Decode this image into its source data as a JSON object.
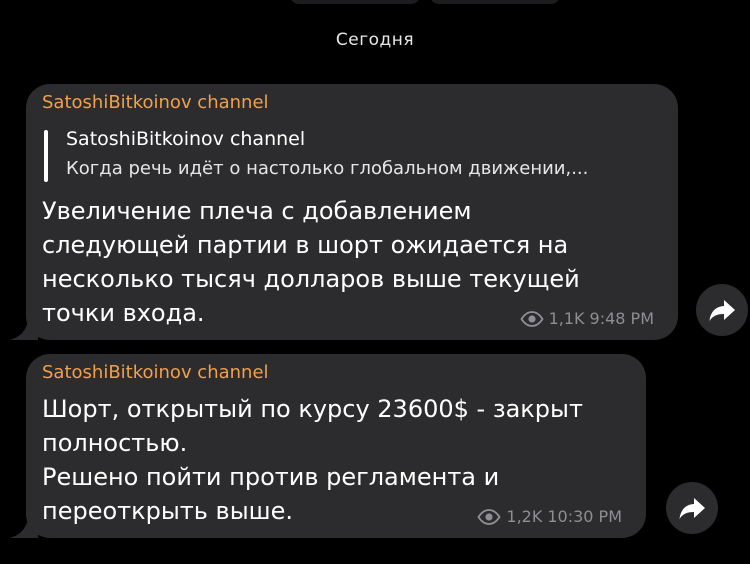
{
  "date_separator": "Сегодня",
  "messages": [
    {
      "sender": "SatoshiBitkoinov channel",
      "reply": {
        "author": "SatoshiBitkoinov channel",
        "text": "Когда речь идёт о настолько глобальном движении,..."
      },
      "text": "Увеличение плеча с добавлением\nследующей партии в шорт ожидается на\nнесколько тысяч долларов выше текущей\nточки входа.",
      "views": "1,1K",
      "time": "9:48 PM",
      "share_icon": "share-arrow-icon"
    },
    {
      "sender": "SatoshiBitkoinov channel",
      "text": "Шорт, открытый по курсу 23600$ - закрыт\nполностью.\nРешено пойти против регламента и\nпереоткрыть выше.",
      "views": "1,2K",
      "time": "10:30 PM",
      "share_icon": "share-arrow-icon"
    }
  ],
  "colors": {
    "background": "#000000",
    "bubble": "#2c2c2e",
    "sender_name": "#f1a04b",
    "meta": "#8e8e93"
  }
}
